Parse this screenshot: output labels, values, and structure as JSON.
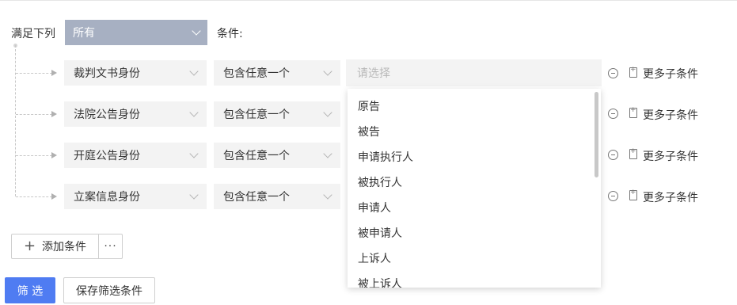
{
  "header": {
    "match_label": "满足下列",
    "match_value": "所有",
    "conditions_label": "条件:"
  },
  "rows": [
    {
      "field": "裁判文书身份",
      "operator": "包含任意一个",
      "more": "更多子条件"
    },
    {
      "field": "法院公告身份",
      "operator": "包含任意一个",
      "more": "更多子条件"
    },
    {
      "field": "开庭公告身份",
      "operator": "包含任意一个",
      "more": "更多子条件"
    },
    {
      "field": "立案信息身份",
      "operator": "包含任意一个",
      "more": "更多子条件"
    }
  ],
  "value_input": {
    "placeholder": "请选择"
  },
  "dropdown": {
    "options": [
      "原告",
      "被告",
      "申请执行人",
      "被执行人",
      "申请人",
      "被申请人",
      "上诉人",
      "被上诉人"
    ]
  },
  "actions": {
    "add_condition": "添加条件",
    "more_dots": "···",
    "filter": "筛 选",
    "save": "保存筛选条件"
  },
  "colors": {
    "primary": "#4f7cf2",
    "match_select_bg": "#a7b0c2"
  },
  "icons": {
    "minus": "minus-circle-icon",
    "doc": "add-document-icon",
    "plus": "plus-icon",
    "chevron": "chevron-down-icon"
  }
}
